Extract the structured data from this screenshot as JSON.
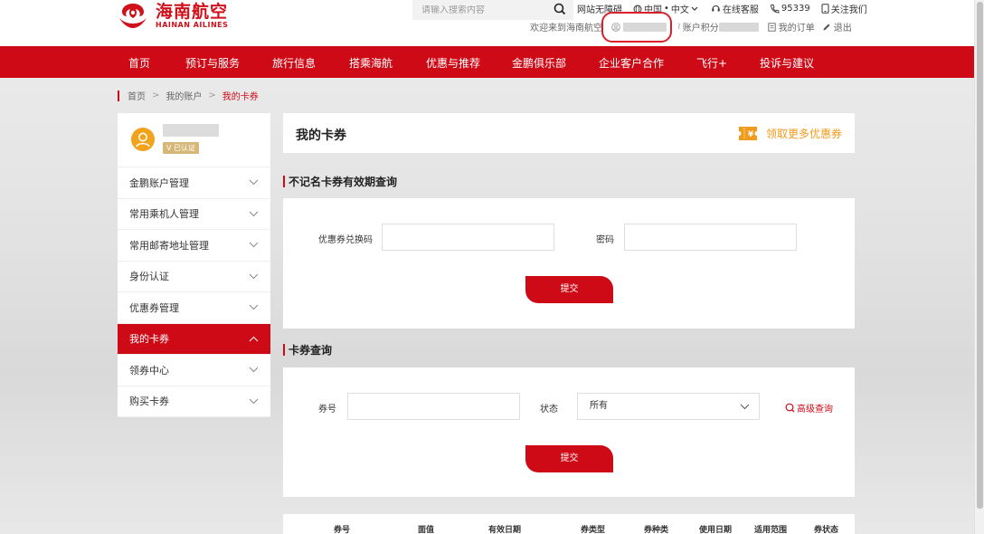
{
  "header": {
    "logo_cn": "海南航空",
    "logo_en": "HAINAN AILINES",
    "search_placeholder": "请输入搜索内容",
    "accessibility": "网站无障碍",
    "region": "中国",
    "language": "中文",
    "service": "在线客服",
    "phone": "95339",
    "follow": "关注我们",
    "welcome": "欢迎来到海南航空",
    "points": "账户积分",
    "orders": "我的订单",
    "logout": "退出"
  },
  "nav": {
    "items": [
      "首页",
      "预订与服务",
      "旅行信息",
      "搭乘海航",
      "优惠与推荐",
      "金鹏俱乐部",
      "企业客户合作",
      "飞行+",
      "投诉与建议"
    ]
  },
  "breadcrumb": {
    "items": [
      "首页",
      "我的账户",
      "我的卡券"
    ],
    "separator": ">"
  },
  "sidebar": {
    "verified_badge": "V 已认证",
    "items": [
      {
        "label": "金鹏账户管理",
        "active": false
      },
      {
        "label": "常用乘机人管理",
        "active": false
      },
      {
        "label": "常用邮寄地址管理",
        "active": false
      },
      {
        "label": "身份认证",
        "active": false
      },
      {
        "label": "优惠券管理",
        "active": false
      },
      {
        "label": "我的卡券",
        "active": true
      },
      {
        "label": "领券中心",
        "active": false
      },
      {
        "label": "购买卡券",
        "active": false
      }
    ]
  },
  "main": {
    "title": "我的卡券",
    "more_coupons": "领取更多优惠券",
    "coupon_icon_text": "¥",
    "anonymous": {
      "section_title": "不记名卡券有效期查询",
      "code_label": "优惠券兑换码",
      "code_value": "",
      "password_label": "密码",
      "password_value": "",
      "submit": "提交"
    },
    "query": {
      "section_title": "卡券查询",
      "number_label": "券号",
      "number_value": "",
      "status_label": "状态",
      "status_value": "所有",
      "advanced": "高级查询",
      "submit": "提交"
    },
    "table_headers": [
      "券号",
      "面值",
      "有效日期",
      "券类型",
      "券种类",
      "使用日期",
      "适用范围",
      "券状态"
    ]
  },
  "colors": {
    "brand_red": "#cf0a17",
    "accent_orange": "#f29a1b",
    "verified_gold": "#d6b777",
    "highlight_ring": "#d9212c"
  }
}
